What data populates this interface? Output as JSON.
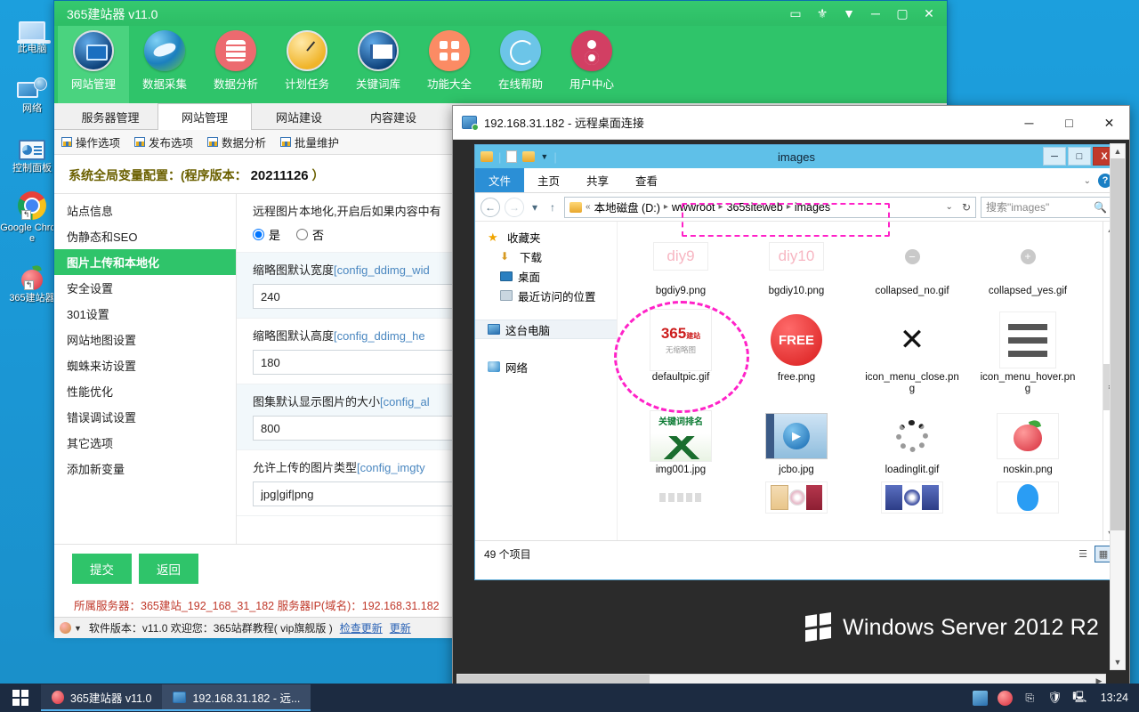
{
  "desktop": {
    "icons": [
      {
        "label": "此电脑",
        "icon": "this-pc-icon"
      },
      {
        "label": "网络",
        "icon": "network-icon"
      },
      {
        "label": "控制面板",
        "icon": "control-panel-icon"
      },
      {
        "label": "Google Chrome",
        "icon": "chrome-icon"
      },
      {
        "label": "365建站器",
        "icon": "apple-icon"
      }
    ]
  },
  "app365": {
    "title": "365建站器 v11.0",
    "window_buttons": [
      "message-icon",
      "gift-icon",
      "dropdown-icon",
      "minimize",
      "maximize",
      "close"
    ],
    "ribbon": [
      {
        "label": "网站管理",
        "icon": "site-manage-icon",
        "active": true
      },
      {
        "label": "数据采集",
        "icon": "data-collect-icon",
        "active": false
      },
      {
        "label": "数据分析",
        "icon": "data-analysis-icon",
        "active": false
      },
      {
        "label": "计划任务",
        "icon": "scheduled-task-icon",
        "active": false
      },
      {
        "label": "关键词库",
        "icon": "keyword-library-icon",
        "active": false
      },
      {
        "label": "功能大全",
        "icon": "features-icon",
        "active": false
      },
      {
        "label": "在线帮助",
        "icon": "online-help-icon",
        "active": false
      },
      {
        "label": "用户中心",
        "icon": "user-center-icon",
        "active": false
      }
    ],
    "tabs": [
      {
        "label": "服务器管理",
        "active": false
      },
      {
        "label": "网站管理",
        "active": true
      },
      {
        "label": "网站建设",
        "active": false
      },
      {
        "label": "内容建设",
        "active": false
      }
    ],
    "subbar": [
      "操作选项",
      "发布选项",
      "数据分析",
      "批量维护"
    ],
    "config_title_prefix": "系统全局变量配置：(程序版本：",
    "config_version": "20211126",
    "config_title_suffix": "）",
    "leftnav": [
      {
        "label": "站点信息",
        "active": false
      },
      {
        "label": "伪静态和SEO",
        "active": false
      },
      {
        "label": "图片上传和本地化",
        "active": true
      },
      {
        "label": "安全设置",
        "active": false
      },
      {
        "label": "301设置",
        "active": false
      },
      {
        "label": "网站地图设置",
        "active": false
      },
      {
        "label": "蜘蛛来访设置",
        "active": false
      },
      {
        "label": "性能优化",
        "active": false
      },
      {
        "label": "错误调试设置",
        "active": false
      },
      {
        "label": "其它选项",
        "active": false
      },
      {
        "label": "添加新变量",
        "active": false
      }
    ],
    "form": [
      {
        "label": "远程图片本地化,开启后如果内容中有",
        "type": "radio",
        "options": [
          {
            "label": "是",
            "checked": true
          },
          {
            "label": "否",
            "checked": false
          }
        ]
      },
      {
        "label": "缩略图默认宽度",
        "code": "[config_ddimg_wid",
        "type": "text",
        "value": "240"
      },
      {
        "label": "缩略图默认高度",
        "code": "[config_ddimg_he",
        "type": "text",
        "value": "180"
      },
      {
        "label": "图集默认显示图片的大小",
        "code": "[config_al",
        "type": "text",
        "value": "800"
      },
      {
        "label": "允许上传的图片类型",
        "code": "[config_imgty",
        "type": "text",
        "value": "jpg|gif|png"
      }
    ],
    "buttons": {
      "submit": "提交",
      "back": "返回"
    },
    "server_line": "所属服务器：365建站_192_168_31_182 服务器IP(域名)：192.168.31.182",
    "statusbar": {
      "text": "软件版本：v11.0  欢迎您：365站群教程( vip旗舰版 )",
      "link1": "检查更新",
      "link2": "更新"
    }
  },
  "rdp": {
    "title": "192.168.31.182 - 远程桌面连接",
    "buttons": {
      "minimize": "─",
      "maximize": "□",
      "close": "✕"
    },
    "brand": "Windows Server 2012 R2"
  },
  "explorer": {
    "title": "images",
    "quick_toolbar": [
      "folder-icon",
      "properties-icon",
      "new-folder-icon",
      "dropdown-icon"
    ],
    "window_buttons": {
      "minimize": "─",
      "maximize": "□",
      "close": "X"
    },
    "menu": [
      "文件",
      "主页",
      "共享",
      "查看"
    ],
    "address": {
      "drive": "本地磁盘 (D:)",
      "crumbs": [
        "wwwroot",
        "365siteweb",
        "images"
      ],
      "search_placeholder": "搜索\"images\""
    },
    "navpane": [
      {
        "label": "收藏夹",
        "icon": "star-icon",
        "selected": false
      },
      {
        "label": "下载",
        "icon": "download-icon",
        "selected": false
      },
      {
        "label": "桌面",
        "icon": "desktop-icon",
        "selected": false
      },
      {
        "label": "最近访问的位置",
        "icon": "recent-places-icon",
        "selected": false
      },
      {
        "label": "这台电脑",
        "icon": "this-pc-icon",
        "selected": true
      },
      {
        "label": "网络",
        "icon": "network-icon",
        "selected": false
      }
    ],
    "files": [
      {
        "name": "bgdiy9.png",
        "thumb": "diy9-thumb"
      },
      {
        "name": "bgdiy10.png",
        "thumb": "diy10-thumb"
      },
      {
        "name": "collapsed_no.gif",
        "thumb": "minus-circle-thumb"
      },
      {
        "name": "collapsed_yes.gif",
        "thumb": "plus-circle-thumb"
      },
      {
        "name": "defaultpic.gif",
        "thumb": "365-nothumb"
      },
      {
        "name": "free.png",
        "thumb": "free-badge"
      },
      {
        "name": "icon_menu_close.png",
        "thumb": "x-mark"
      },
      {
        "name": "icon_menu_hover.png",
        "thumb": "hamburger"
      },
      {
        "name": "img001.jpg",
        "thumb": "keyword-rank"
      },
      {
        "name": "jcbo.jpg",
        "thumb": "player-screenshot"
      },
      {
        "name": "loadinglit.gif",
        "thumb": "spinner"
      },
      {
        "name": "noskin.png",
        "thumb": "apple"
      },
      {
        "name": "",
        "thumb": "partial-row-1"
      },
      {
        "name": "",
        "thumb": "books-cd"
      },
      {
        "name": "",
        "thumb": "software-box"
      },
      {
        "name": "",
        "thumb": "qq-penguin"
      }
    ],
    "status": {
      "count": "49 个项目"
    },
    "view_buttons": [
      "details-view-icon",
      "icons-view-icon"
    ]
  },
  "taskbar": {
    "start": "start-button",
    "items": [
      {
        "label": "365建站器 v11.0",
        "icon": "apple-icon",
        "active": true
      },
      {
        "label": "192.168.31.182 - 远...",
        "icon": "rdp-icon",
        "active": false
      }
    ],
    "tray": [
      "network-icon",
      "apple-icon",
      "usb-icon",
      "shield-warning-icon",
      "display-icon"
    ],
    "clock": "13:24"
  }
}
